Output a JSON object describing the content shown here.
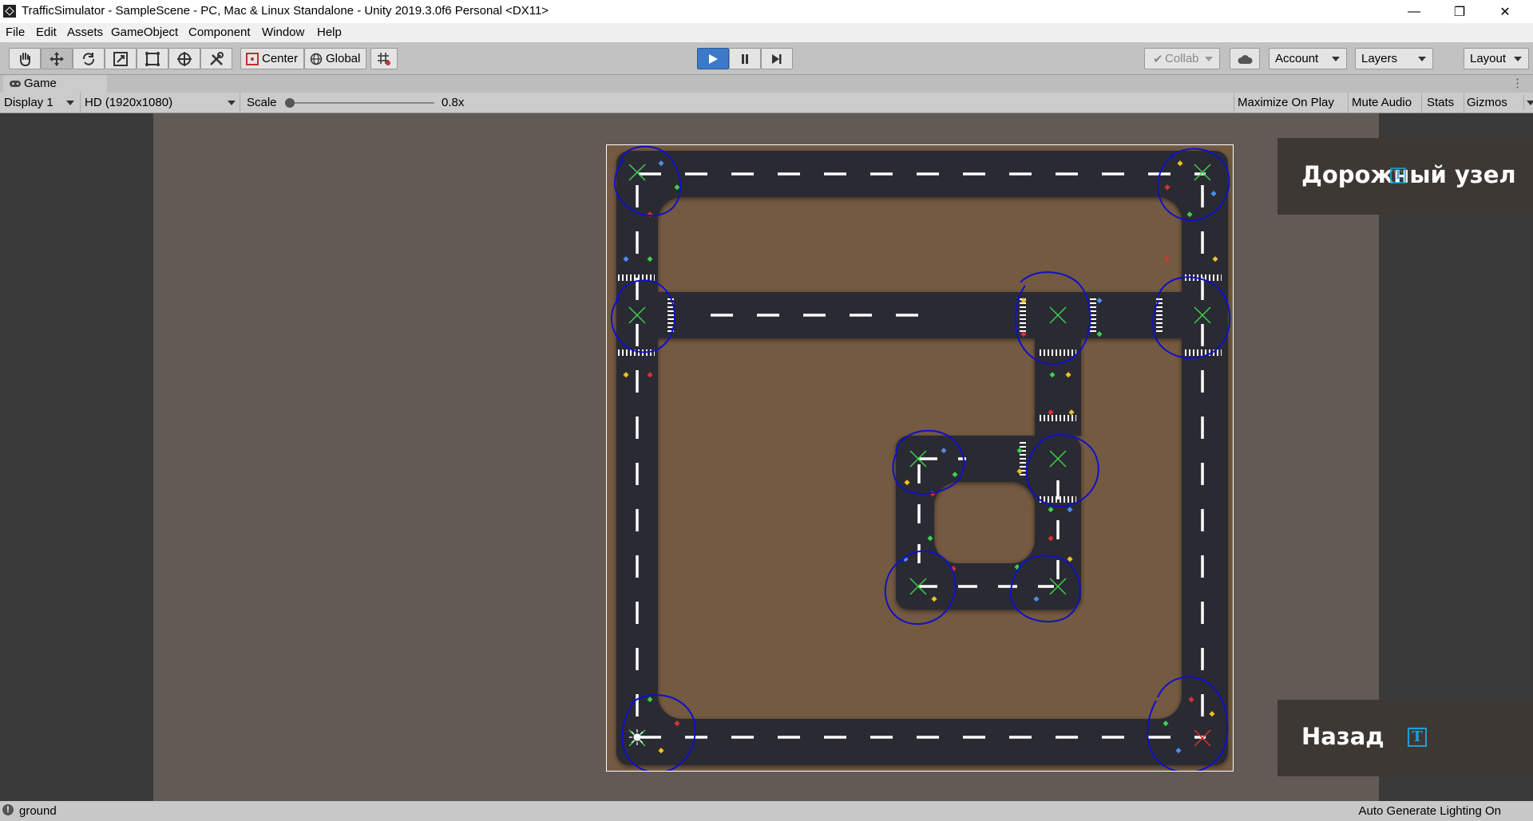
{
  "window": {
    "title": "TrafficSimulator - SampleScene - PC, Mac & Linux Standalone - Unity 2019.3.0f6 Personal <DX11>",
    "minimize": "—",
    "maximize": "❐",
    "close": "✕"
  },
  "menu": [
    "File",
    "Edit",
    "Assets",
    "GameObject",
    "Component",
    "Window",
    "Help"
  ],
  "toolbar": {
    "tools": [
      "hand-tool",
      "move-tool",
      "rotate-tool",
      "scale-tool",
      "rect-tool",
      "transform-tool",
      "custom-tool"
    ],
    "pivot": "Center",
    "space": "Global",
    "collab": "Collab",
    "account": "Account",
    "layers": "Layers",
    "layout": "Layout"
  },
  "tab": {
    "label": "Game"
  },
  "gamebar": {
    "display": "Display 1",
    "resolution": "HD (1920x1080)",
    "scale_label": "Scale",
    "scale_value": "0.8x",
    "maximize_on_play": "Maximize On Play",
    "mute_audio": "Mute Audio",
    "stats": "Stats",
    "gizmos": "Gizmos"
  },
  "game_ui": {
    "panel_top": "Дорожный узел",
    "panel_bottom": "Назад",
    "text_icon": "T"
  },
  "status": {
    "left": "ground",
    "right": "Auto Generate Lighting On"
  },
  "colors": {
    "ground": "#735a41",
    "road": "#2b2c30",
    "lane_marking": "#ffffff",
    "annotation_circle": "#1010c8",
    "node_x": "#3ccf4e",
    "panel": "#3e3834",
    "play_active": "#3c7ac8"
  }
}
